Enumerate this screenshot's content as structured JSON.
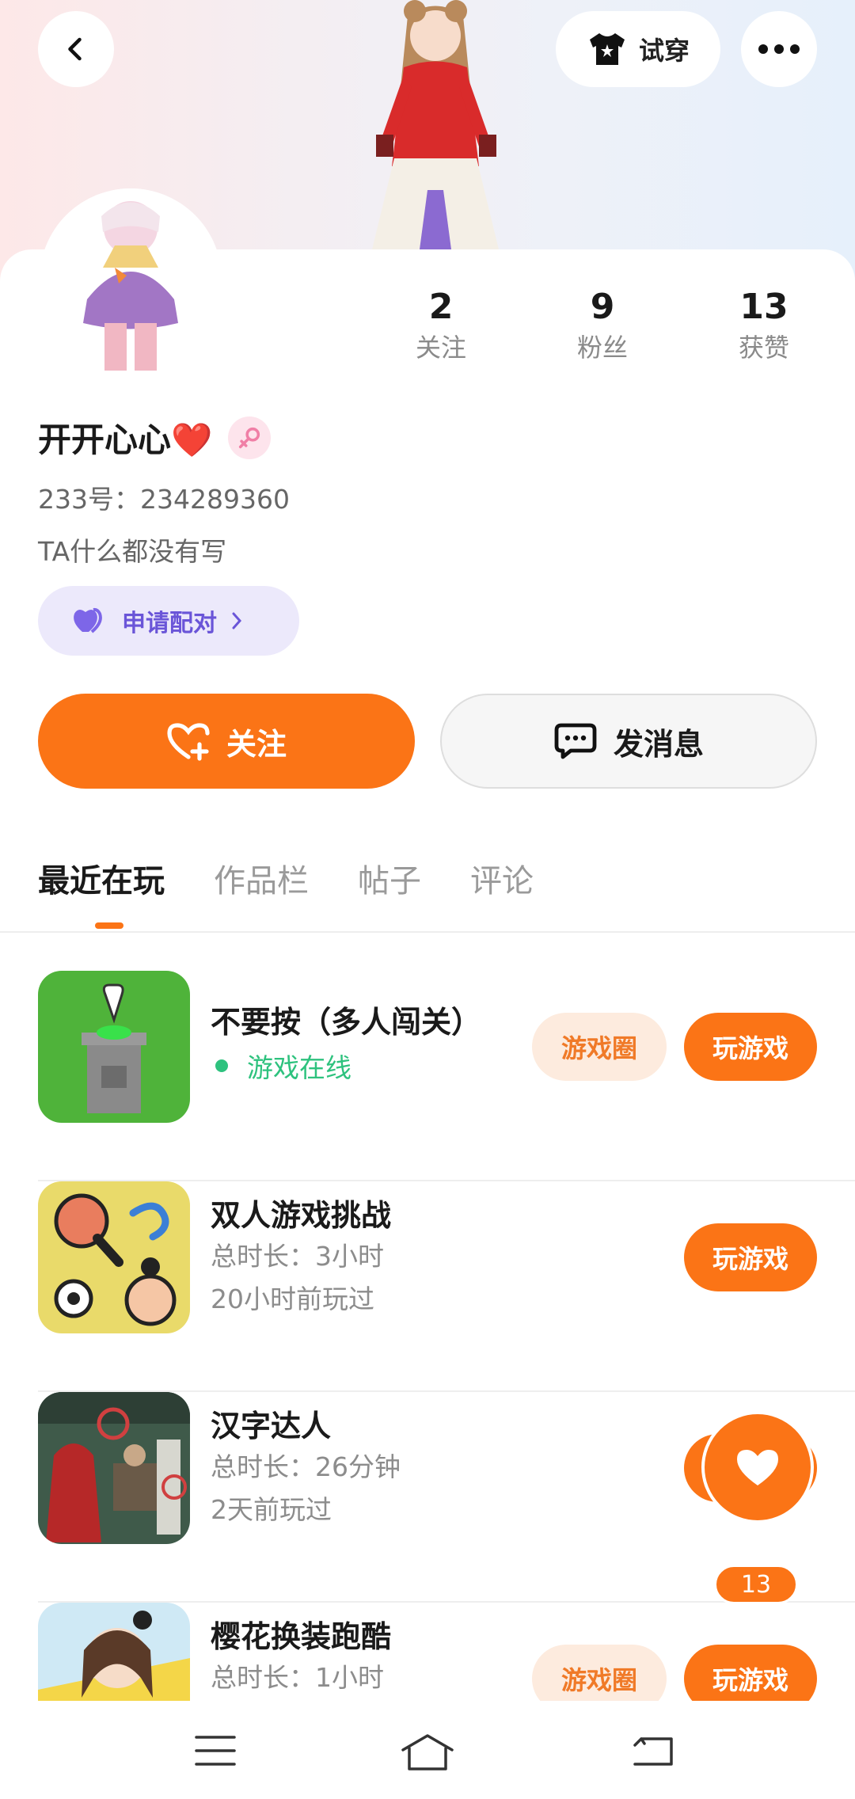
{
  "header": {
    "back_icon": "chevron-left-icon",
    "tryon_label": "试穿",
    "tryon_icon": "tshirt-icon",
    "more_icon": "ellipsis-icon"
  },
  "profile": {
    "stats": [
      {
        "num": "2",
        "label": "关注"
      },
      {
        "num": "9",
        "label": "粉丝"
      },
      {
        "num": "13",
        "label": "获赞"
      }
    ],
    "name": "开开心心❤️",
    "gender_icon": "female-icon",
    "uid": "233号：234289360",
    "bio": "TA什么都没有写",
    "pair_label": "申请配对",
    "follow_label": "关注",
    "message_label": "发消息"
  },
  "tabs": [
    "最近在玩",
    "作品栏",
    "帖子",
    "评论"
  ],
  "games": [
    {
      "title": "不要按（多人闯关）",
      "status": "游戏在线",
      "duration": "",
      "last": "",
      "circle": "游戏圈",
      "play": "玩游戏"
    },
    {
      "title": "双人游戏挑战",
      "status": "",
      "duration": "总时长：3小时",
      "last": "20小时前玩过",
      "circle": "",
      "play": "玩游戏"
    },
    {
      "title": "汉字达人",
      "status": "",
      "duration": "总时长：26分钟",
      "last": "2天前玩过",
      "circle": "",
      "play": "玩游戏"
    },
    {
      "title": "樱花换装跑酷",
      "status": "",
      "duration": "总时长：1小时",
      "last": "",
      "circle": "游戏圈",
      "play": "玩游戏"
    }
  ],
  "like_fab": {
    "count": "13",
    "icon": "heart-icon"
  },
  "nav": [
    "menu-icon",
    "home-icon",
    "back-icon"
  ],
  "colors": {
    "accent": "#fb7416",
    "online": "#2ec27e",
    "pair": "#6a55d8"
  }
}
